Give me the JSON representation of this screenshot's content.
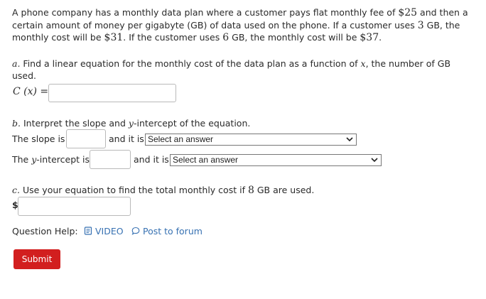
{
  "problem": {
    "intro_line1": "A phone company has a monthly data plan where a customer pays flat monthly fee of",
    "intro_fee": "$25",
    "intro_line1_end": "and then a",
    "intro_line2a": "certain amount of money per gigabyte (GB) of data used on the phone. If a customer uses",
    "intro_gb1": "3",
    "intro_line2b": "GB, the",
    "intro_line3a": "monthly cost will be",
    "intro_cost1": "$31",
    "intro_line3b": ". If the customer uses",
    "intro_gb2": "6",
    "intro_line3c": "GB, the monthly cost will be",
    "intro_cost2": "$37",
    "intro_line3d": "."
  },
  "part_a": {
    "prefix": "a.",
    "text_line1": "Find a linear equation for the monthly cost of the data plan as a function of",
    "var": "x",
    "text_line1_end": ", the number of GB",
    "text_line2": "used.",
    "func_label": "C (x) =",
    "answer_value": ""
  },
  "part_b": {
    "prefix": "b.",
    "text_a": "Interpret the slope and",
    "var": "y",
    "text_b": "-intercept of the equation.",
    "slope_label": "The slope is",
    "slope_value": "",
    "and_it_is": "and it is",
    "slope_select": "Select an answer",
    "intercept_label_a": "The",
    "intercept_label_b": "-intercept is",
    "intercept_value": "",
    "intercept_select": "Select an answer"
  },
  "part_c": {
    "prefix": "c.",
    "text_a": "Use your equation to find the total monthly cost if",
    "gb": "8",
    "text_b": "GB are used.",
    "currency": "$",
    "answer_value": ""
  },
  "help": {
    "label": "Question Help:",
    "video": "VIDEO",
    "forum": "Post to forum"
  },
  "submit_label": "Submit"
}
